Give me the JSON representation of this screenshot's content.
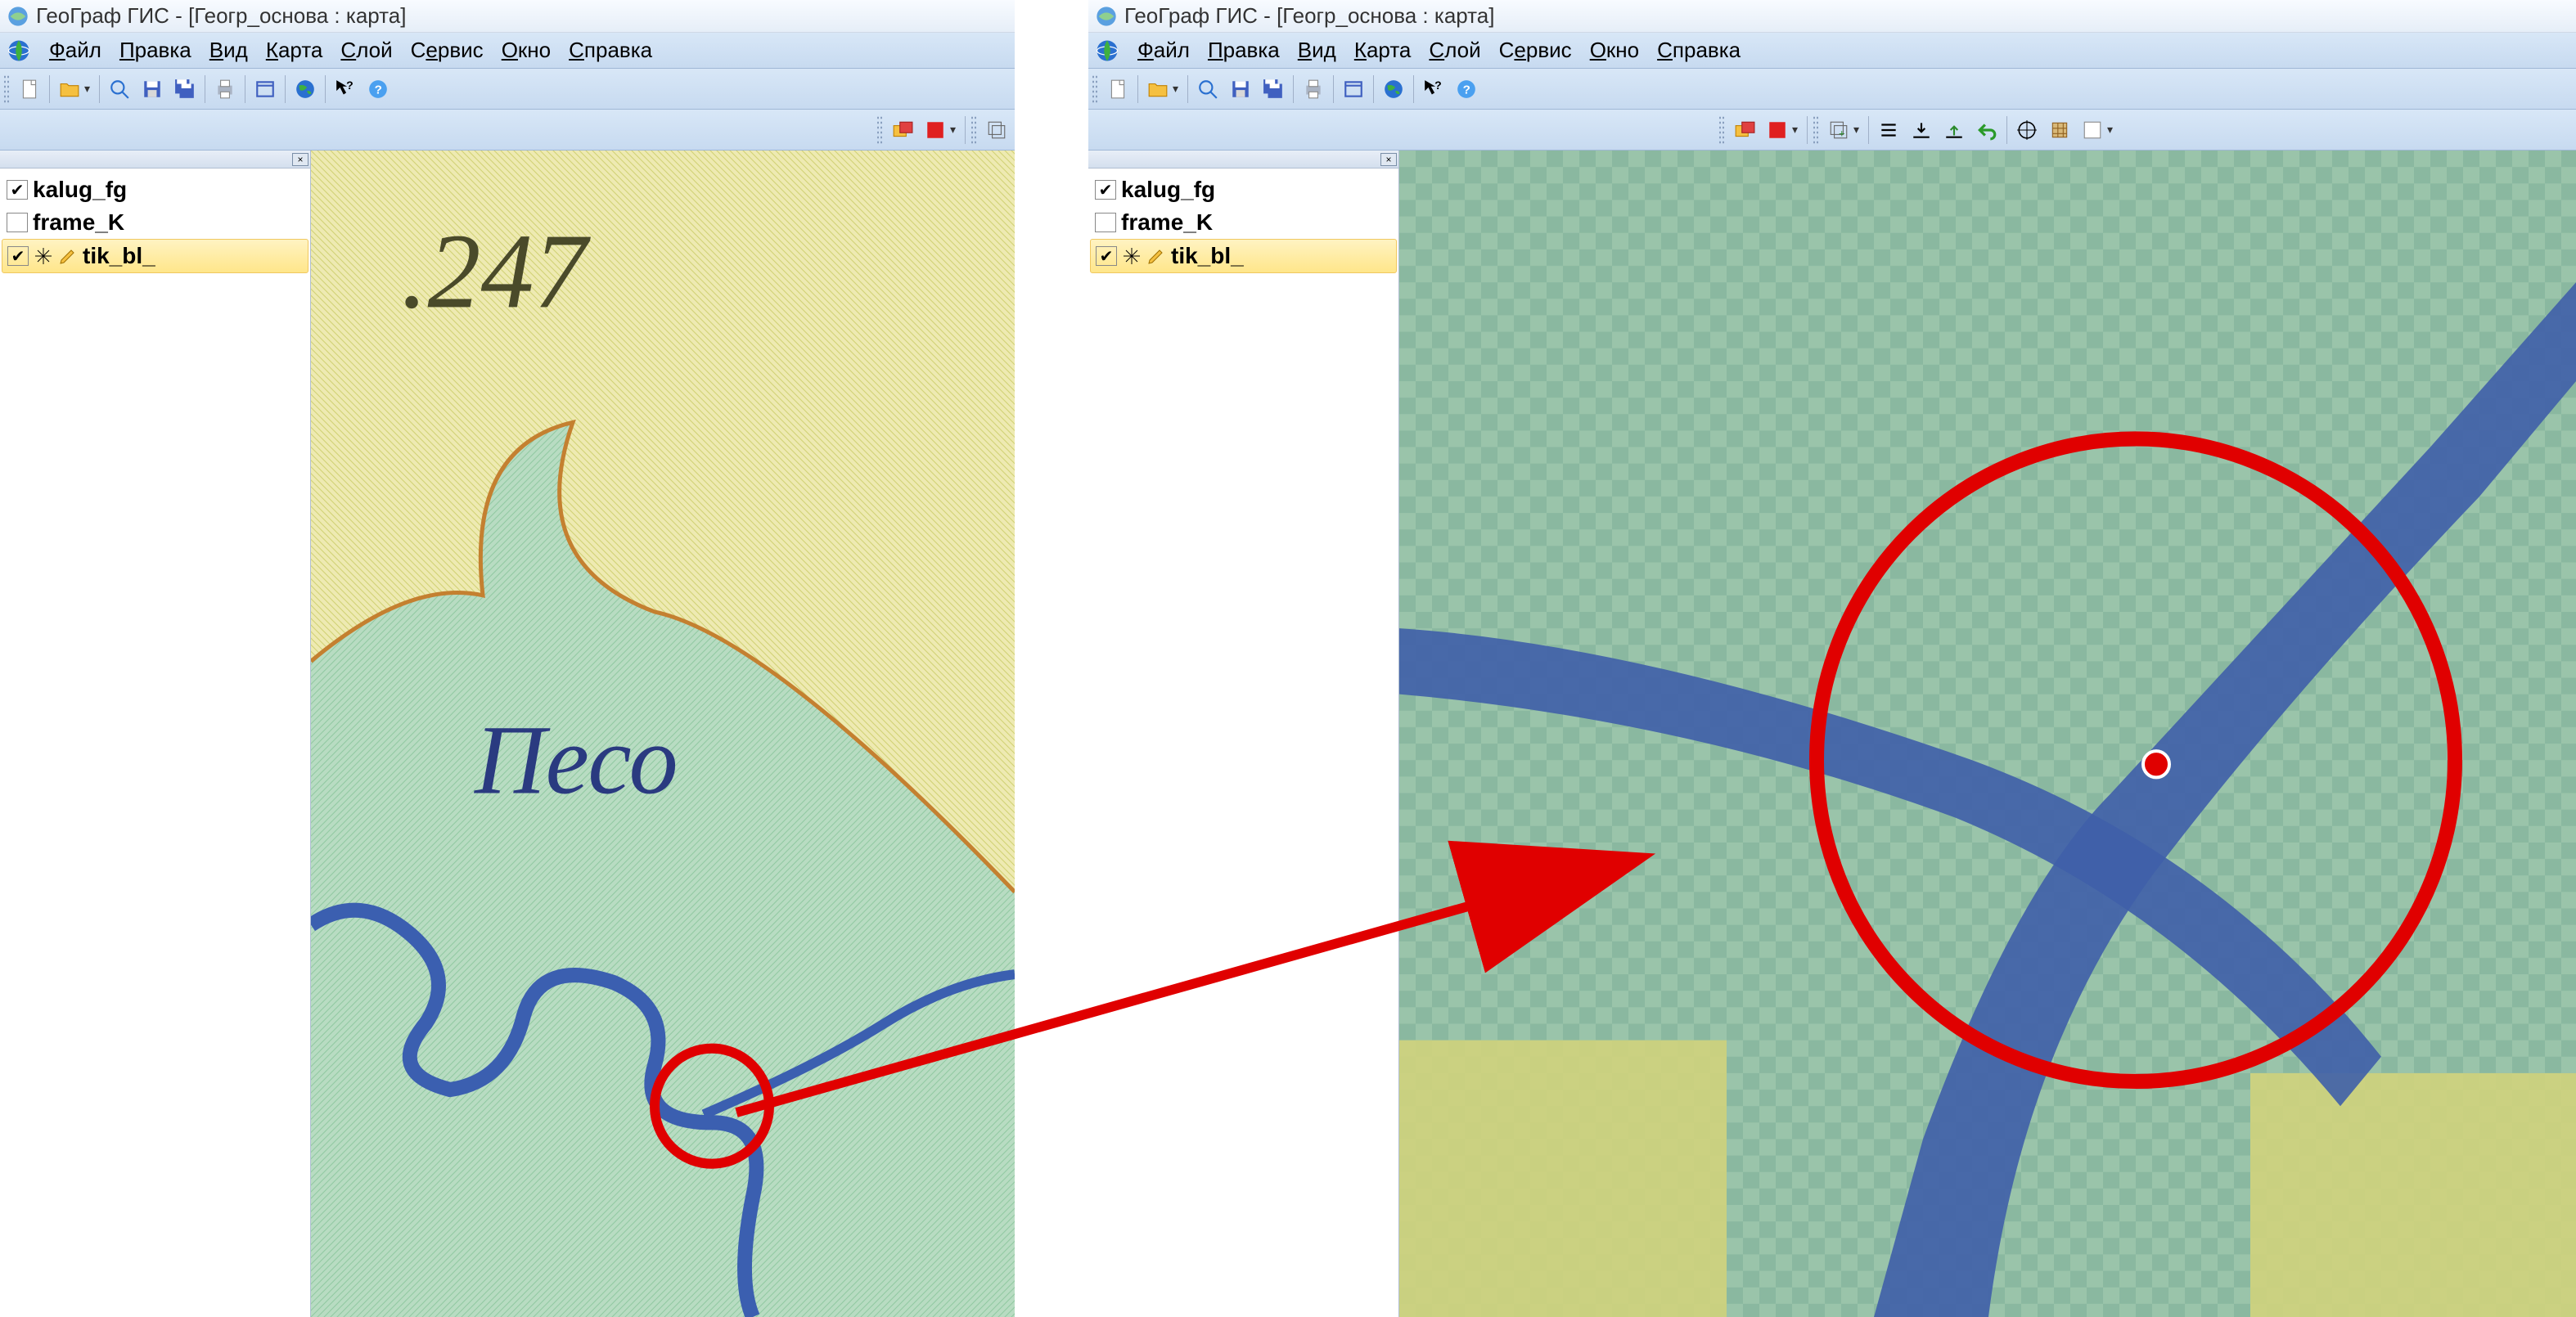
{
  "app": {
    "title_full": "ГеоГраф ГИС - [Геогр_основа : карта]"
  },
  "menus": {
    "file": "Файл",
    "edit": "Правка",
    "view": "Вид",
    "map": "Карта",
    "layer": "Слой",
    "service": "Сервис",
    "window": "Окно",
    "help": "Справка"
  },
  "layers": {
    "items": [
      {
        "name": "kalug_fg",
        "checked": true,
        "selected": false,
        "tools": false
      },
      {
        "name": "frame_K",
        "checked": false,
        "selected": false,
        "tools": false
      },
      {
        "name": "tik_bl_",
        "checked": true,
        "selected": true,
        "tools": true
      }
    ]
  },
  "map_left": {
    "spot_height": ".247",
    "river_label": "Песо"
  },
  "icons": {
    "app": "app-icon",
    "globe": "globe-icon",
    "new": "new-file-icon",
    "open": "open-folder-icon",
    "zoom": "magnifier-icon",
    "save": "save-icon",
    "save_all": "save-all-icon",
    "print": "print-icon",
    "window": "window-icon",
    "earth": "earth-icon",
    "help_cursor": "help-arrow-icon",
    "help_round": "help-round-icon",
    "red_sq": "red-square-icon",
    "yellow_red": "layer-color-icon",
    "layers_plus": "layers-icon",
    "align_left": "align-left-icon",
    "align_bottom": "align-bottom-icon",
    "align_top": "align-top-icon",
    "undo_green": "undo-green-icon",
    "target": "target-icon",
    "grid_brown": "grid-icon",
    "empty_rect": "empty-rect-icon",
    "sparkle": "sparkle-icon",
    "pencil": "pencil-icon"
  }
}
